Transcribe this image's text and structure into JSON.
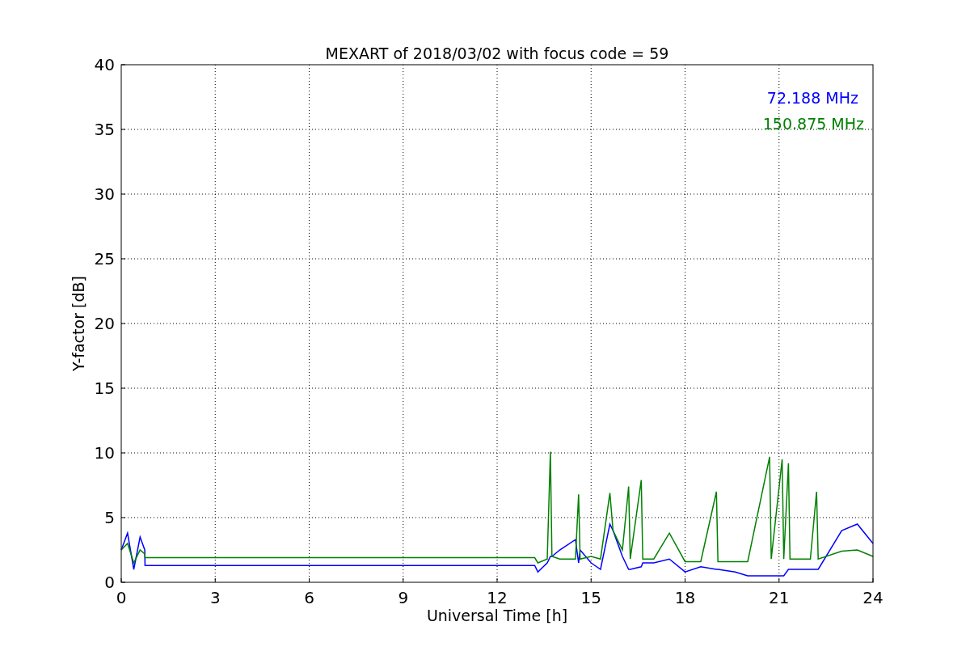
{
  "chart_data": {
    "type": "line",
    "title": "MEXART of 2018/03/02 with focus code = 59",
    "xlabel": "Universal Time [h]",
    "ylabel": "Y-factor [dB]",
    "x": [
      0,
      0.2,
      0.4,
      0.6,
      0.75,
      0.76,
      13.2,
      13.3,
      13.6,
      13.7,
      13.75,
      14,
      14.5,
      14.6,
      14.65,
      15,
      15.3,
      15.6,
      15.7,
      16,
      16.2,
      16.25,
      16.6,
      16.65,
      17,
      17.5,
      18,
      18.5,
      19,
      19.05,
      19.6,
      20,
      20.7,
      20.75,
      21.1,
      21.15,
      21.3,
      21.35,
      22,
      22.2,
      22.25,
      23,
      23.5,
      24
    ],
    "series": [
      {
        "name": "72.188 MHz",
        "color": "#0000ff",
        "values": [
          2.5,
          3.8,
          1,
          3.5,
          2.5,
          1.3,
          1.3,
          0.8,
          1.5,
          2,
          2,
          2.5,
          3.3,
          1.5,
          2.5,
          1.5,
          1,
          4.5,
          4,
          2,
          1,
          1,
          1.2,
          1.5,
          1.5,
          1.8,
          0.8,
          1.2,
          1,
          1,
          0.8,
          0.5,
          0.5,
          0.5,
          0.5,
          0.5,
          1,
          1,
          1,
          1,
          1,
          4,
          4.5,
          3
        ]
      },
      {
        "name": "150.875 MHz",
        "color": "#008000",
        "values": [
          2.5,
          3,
          1.5,
          2.5,
          2.2,
          1.9,
          1.9,
          1.5,
          1.8,
          10.1,
          2,
          1.8,
          1.8,
          6.8,
          1.8,
          2,
          1.8,
          6.9,
          4,
          2.5,
          7.4,
          1.8,
          7.9,
          1.8,
          1.8,
          3.8,
          1.6,
          1.6,
          7,
          1.6,
          1.6,
          1.6,
          9.7,
          1.8,
          9.5,
          1.8,
          9.2,
          1.8,
          1.8,
          7,
          1.8,
          2.4,
          2.5,
          2
        ]
      }
    ],
    "grid": true,
    "xlim": [
      0,
      24
    ],
    "ylim": [
      0,
      40
    ],
    "xticks": [
      0,
      3,
      6,
      9,
      12,
      15,
      18,
      21,
      24
    ],
    "yticks": [
      0,
      5,
      10,
      15,
      20,
      25,
      30,
      35,
      40
    ]
  }
}
